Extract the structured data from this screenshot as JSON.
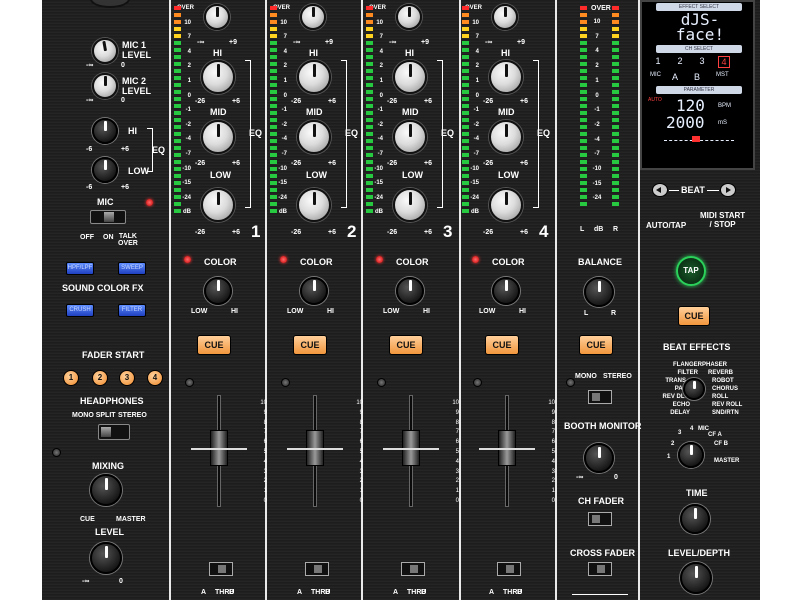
{
  "mic": {
    "mic1_level": "MIC 1\nLEVEL",
    "mic2_level": "MIC 2\nLEVEL",
    "hi": "HI",
    "low": "LOW",
    "eq": "EQ",
    "mic_switch_label": "MIC",
    "off": "OFF",
    "on": "ON",
    "talk_over": "TALK\nOVER",
    "minus_inf": "-∞",
    "zero": "0",
    "minus6": "-6",
    "plus6": "+6"
  },
  "sound_color_fx": {
    "title": "SOUND COLOR FX",
    "buttons": [
      "HPF/LPF",
      "SWEEP",
      "CRUSH",
      "FILTER"
    ]
  },
  "fader_start": {
    "title": "FADER START",
    "buttons": [
      "1",
      "2",
      "3",
      "4"
    ]
  },
  "headphones": {
    "title": "HEADPHONES",
    "mono_split": "MONO SPLIT",
    "stereo": "STEREO",
    "mixing": "MIXING",
    "cue": "CUE",
    "master": "MASTER",
    "level": "LEVEL",
    "minus_inf": "-∞",
    "zero": "0"
  },
  "channel_common": {
    "hi": "HI",
    "mid": "MID",
    "low": "LOW",
    "eq": "EQ",
    "color": "COLOR",
    "color_low": "LOW",
    "color_hi": "HI",
    "cue": "CUE",
    "minus_inf": "-∞",
    "plus9": "+9",
    "minus26": "-26",
    "plus6": "+6",
    "crossfader_assign": [
      "A",
      "THRU",
      "B"
    ],
    "meter_labels": [
      "OVER",
      "10",
      "7",
      "4",
      "2",
      "1",
      "0",
      "-1",
      "-2",
      "-4",
      "-7",
      "-10",
      "-15",
      "-24",
      "dB"
    ],
    "fader_scale": [
      "10",
      "9",
      "8",
      "7",
      "6",
      "5",
      "4",
      "3",
      "2",
      "1",
      "0"
    ]
  },
  "channels": [
    {
      "number": "1"
    },
    {
      "number": "2"
    },
    {
      "number": "3"
    },
    {
      "number": "4"
    }
  ],
  "master_section": {
    "meter_over": "OVER",
    "meter_labels": [
      "10",
      "7",
      "4",
      "2",
      "1",
      "0",
      "-1",
      "-2",
      "-4",
      "-7",
      "-10",
      "-15",
      "-24"
    ],
    "meter_l": "L",
    "meter_db": "dB",
    "meter_r": "R",
    "balance": "BALANCE",
    "bal_l": "L",
    "bal_r": "R",
    "cue": "CUE",
    "mono": "MONO",
    "stereo": "STEREO",
    "booth_monitor": "BOOTH MONITOR",
    "minus_inf": "-∞",
    "zero": "0",
    "ch_fader": "CH FADER",
    "cross_fader": "CROSS FADER"
  },
  "effects": {
    "display": {
      "effect_select": "EFFECT SELECT",
      "effect_name": "dJS-\nface!",
      "ch_select": "CH SELECT",
      "channels": [
        "1",
        "2",
        "3",
        "4"
      ],
      "selected_channel": "4",
      "sources": [
        "MIC",
        "A",
        "B",
        "MST"
      ],
      "parameter": "PARAMETER",
      "auto": "AUTO",
      "bpm_value": "120",
      "bpm_unit": "BPM",
      "ms_value": "2000",
      "ms_unit": "mS"
    },
    "beat": "BEAT",
    "auto_tap": "AUTO/TAP",
    "midi_start_stop": "MIDI START\n/ STOP",
    "tap": "TAP",
    "cue": "CUE",
    "beat_effects": "BEAT EFFECTS",
    "effect_list_left": [
      "FLANGER",
      "FILTER",
      "TRANS",
      "PAN",
      "REV DLY",
      "ECHO",
      "DELAY"
    ],
    "effect_list_right": [
      "PHASER",
      "REVERB",
      "ROBOT",
      "CHORUS",
      "ROLL",
      "REV ROLL",
      "SND/RTN"
    ],
    "channel_select_labels": [
      "1",
      "2",
      "3",
      "4",
      "MIC",
      "CF A",
      "CF B",
      "MASTER"
    ],
    "time": "TIME",
    "level_depth": "LEVEL/DEPTH"
  },
  "colors": {
    "cue_orange": "#f2963d",
    "tap_green": "#2bd15a",
    "fx_blue": "#1f3fbf",
    "led_red": "#ff3333"
  }
}
